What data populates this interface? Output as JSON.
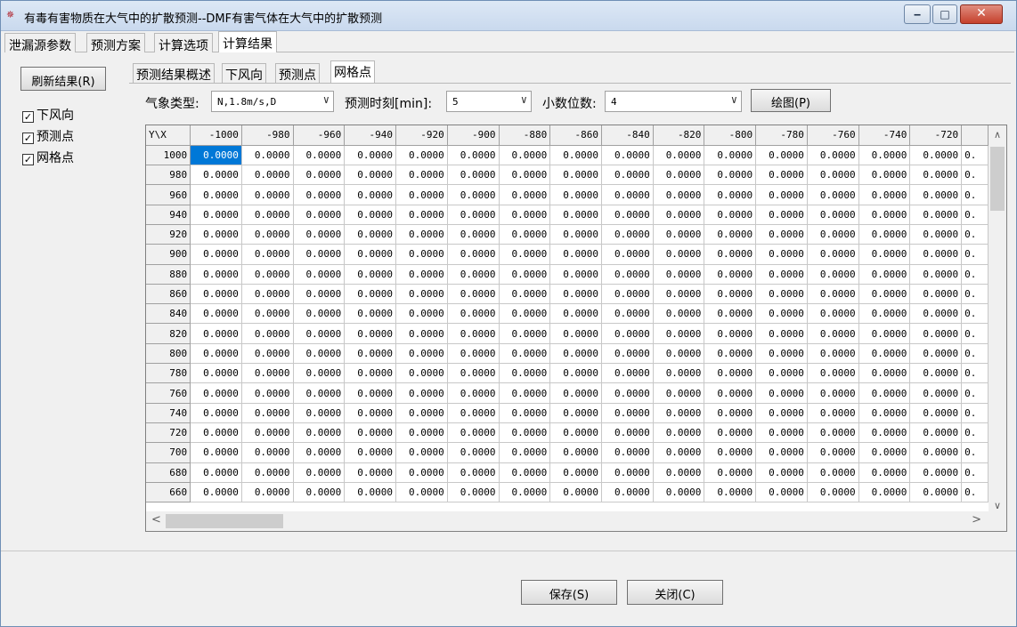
{
  "window": {
    "app_icon_text": "✵",
    "title": "有毒有害物质在大气中的扩散预测--DMF有害气体在大气中的扩散预测",
    "min_glyph": "‒",
    "max_glyph": "□",
    "close_glyph": "✕"
  },
  "top_tabs": [
    {
      "label": "泄漏源参数"
    },
    {
      "label": "预测方案"
    },
    {
      "label": "计算选项"
    },
    {
      "label": "计算结果"
    }
  ],
  "left": {
    "refresh_label": "刷新结果(R)",
    "checkboxes": [
      {
        "label": "下风向",
        "checked": true
      },
      {
        "label": "预测点",
        "checked": true
      },
      {
        "label": "网格点",
        "checked": true
      }
    ],
    "check_glyph": "✓"
  },
  "inner_tabs": [
    {
      "label": "预测结果概述"
    },
    {
      "label": "下风向"
    },
    {
      "label": "预测点"
    },
    {
      "label": "网格点"
    }
  ],
  "controls": {
    "weather_label": "气象类型:",
    "weather_value": "N,1.8m/s,D",
    "time_label": "预测时刻[min]:",
    "time_value": "5",
    "decimals_label": "小数位数:",
    "decimals_value": "4",
    "draw_label": "绘图(P)",
    "arrow_glyph": "∨"
  },
  "grid": {
    "corner": "Y\\X",
    "x_headers": [
      "-1000",
      "-980",
      "-960",
      "-940",
      "-920",
      "-900",
      "-880",
      "-860",
      "-840",
      "-820",
      "-800",
      "-780",
      "-760",
      "-740",
      "-720",
      ""
    ],
    "y_values": [
      "1000",
      "980",
      "960",
      "940",
      "920",
      "900",
      "880",
      "860",
      "840",
      "820",
      "800",
      "780",
      "760",
      "740",
      "720",
      "700",
      "680",
      "660"
    ],
    "cell_value": "0.0000",
    "partial_cell_value": "0.",
    "selected_row": 0,
    "selected_col": 0
  },
  "scroll": {
    "up": "∧",
    "down": "∨",
    "left": "<",
    "right": ">"
  },
  "bottom": {
    "save_label": "保存(S)",
    "close_label": "关闭(C)"
  }
}
